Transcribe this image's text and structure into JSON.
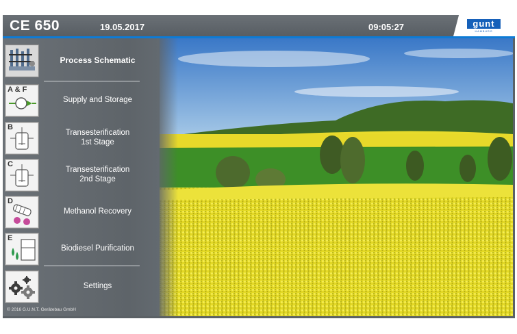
{
  "header": {
    "app_title": "CE 650",
    "date": "19.05.2017",
    "time": "09:05:27",
    "logo_text": "gunt",
    "logo_subtext": "HAMBURG"
  },
  "menu": {
    "items": [
      {
        "letter": "",
        "label_line1": "Process Schematic",
        "label_line2": "",
        "icon": "process-schematic-icon",
        "active": true
      },
      {
        "letter": "A & F",
        "label_line1": "Supply and Storage",
        "label_line2": "",
        "icon": "pump-icon"
      },
      {
        "letter": "B",
        "label_line1": "Transesterification",
        "label_line2": "1st Stage",
        "icon": "reactor-icon"
      },
      {
        "letter": "C",
        "label_line1": "Transesterification",
        "label_line2": "2nd Stage",
        "icon": "reactor-icon"
      },
      {
        "letter": "D",
        "label_line1": "Methanol Recovery",
        "label_line2": "",
        "icon": "evaporator-icon"
      },
      {
        "letter": "E",
        "label_line1": "Biodiesel Purification",
        "label_line2": "",
        "icon": "separator-icon"
      },
      {
        "letter": "",
        "label_line1": "Settings",
        "label_line2": "",
        "icon": "gears-icon"
      }
    ]
  },
  "footer": {
    "copyright": "© 2016 G.U.N.T. Gerätebau GmbH"
  },
  "colors": {
    "accent_blue": "#0d7bd6",
    "sidebar_gray": "#62686d",
    "header_gray": "#60666b",
    "rapeseed_yellow": "#f2e528"
  }
}
